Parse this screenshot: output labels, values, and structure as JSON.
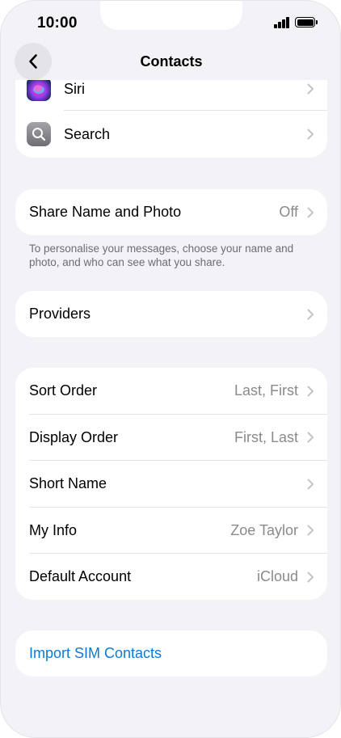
{
  "status_bar": {
    "time": "10:00"
  },
  "nav": {
    "title": "Contacts"
  },
  "group_top": {
    "items": [
      {
        "label": "Siri",
        "icon": "siri-icon"
      },
      {
        "label": "Search",
        "icon": "search-icon"
      }
    ]
  },
  "share": {
    "label": "Share Name and Photo",
    "value": "Off",
    "footer": "To personalise your messages, choose your name and photo, and who can see what you share."
  },
  "providers": {
    "label": "Providers"
  },
  "settings": {
    "items": [
      {
        "label": "Sort Order",
        "value": "Last, First"
      },
      {
        "label": "Display Order",
        "value": "First, Last"
      },
      {
        "label": "Short Name",
        "value": ""
      },
      {
        "label": "My Info",
        "value": "Zoe Taylor"
      },
      {
        "label": "Default Account",
        "value": "iCloud"
      }
    ]
  },
  "import": {
    "label": "Import SIM Contacts"
  },
  "colors": {
    "background": "#f2f2f7",
    "card": "#ffffff",
    "secondary_text": "#8a8a8e",
    "link": "#0a7ad6",
    "separator": "#e3e3e8"
  }
}
